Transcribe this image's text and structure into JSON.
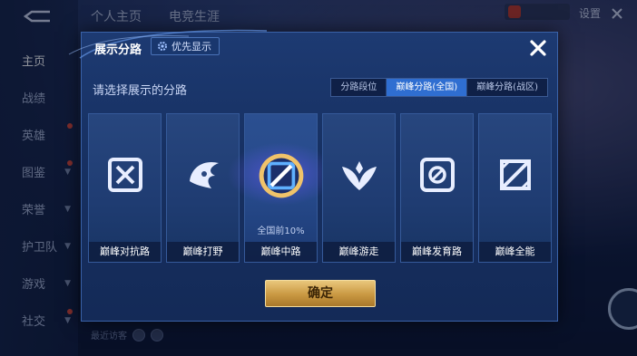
{
  "nav": {
    "items": [
      {
        "label": "主页",
        "active": true,
        "dot": false,
        "chev": false
      },
      {
        "label": "战绩",
        "active": false,
        "dot": false,
        "chev": false
      },
      {
        "label": "英雄",
        "active": false,
        "dot": true,
        "chev": false
      },
      {
        "label": "图鉴",
        "active": false,
        "dot": true,
        "chev": true
      },
      {
        "label": "荣誉",
        "active": false,
        "dot": false,
        "chev": true
      },
      {
        "label": "护卫队",
        "active": false,
        "dot": false,
        "chev": true
      },
      {
        "label": "游戏",
        "active": false,
        "dot": false,
        "chev": true
      },
      {
        "label": "社交",
        "active": false,
        "dot": true,
        "chev": true
      }
    ]
  },
  "header": {
    "tabs": [
      "个人主页",
      "电竞生涯"
    ],
    "settings_label": "设置"
  },
  "footer": {
    "visitors_label": "最近访客"
  },
  "dialog": {
    "title": "展示分路",
    "priority_label": "优先显示",
    "prompt": "请选择展示的分路",
    "tabs": [
      {
        "label": "分路段位",
        "active": false
      },
      {
        "label": "巅峰分路(全国)",
        "active": true
      },
      {
        "label": "巅峰分路(战区)",
        "active": false
      }
    ],
    "lanes": [
      {
        "label": "巅峰对抗路",
        "icon": "clash-lane-icon",
        "rank": ""
      },
      {
        "label": "巅峰打野",
        "icon": "jungle-icon",
        "rank": ""
      },
      {
        "label": "巅峰中路",
        "icon": "mid-lane-icon",
        "rank": "全国前10%"
      },
      {
        "label": "巅峰游走",
        "icon": "roam-icon",
        "rank": ""
      },
      {
        "label": "巅峰发育路",
        "icon": "farm-lane-icon",
        "rank": ""
      },
      {
        "label": "巅峰全能",
        "icon": "all-round-icon",
        "rank": ""
      }
    ],
    "selected_index": 2,
    "confirm_label": "确定"
  },
  "colors": {
    "accent_blue": "#2f6ed1",
    "confirm_gold": "#c99842",
    "dialog_bg": "#173163"
  }
}
